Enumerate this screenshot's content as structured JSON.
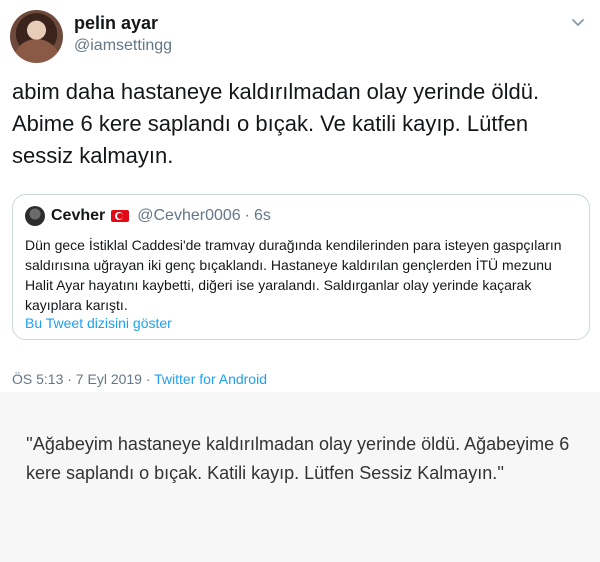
{
  "tweet": {
    "display_name": "pelin ayar",
    "handle": "@iamsettingg",
    "text": "abim daha hastaneye kaldırılmadan olay yerinde öldü. Abime 6 kere saplandı o bıçak. Ve katili kayıp. Lütfen sessiz kalmayın.",
    "timestamp": "ÖS 5:13 · 7 Eyl 2019 · ",
    "source": "Twitter for Android",
    "menu_icon": "chevron-down-icon"
  },
  "quoted_tweet": {
    "display_name": "Cevher",
    "flag_icon": "turkish-flag-icon",
    "handle": "@Cevher0006",
    "separator": "·",
    "time": "6s",
    "text": "Dün gece İstiklal Caddesi'de tramvay durağında kendilerinden para isteyen gaspçıların saldırısına uğrayan iki genç bıçaklandı. Hastaneye kaldırılan gençlerden İTÜ mezunu Halit Ayar hayatını kaybetti, diğeri ise yaralandı. Saldırganlar olay yerinde kaçarak kayıplara karıştı.",
    "thread_link": "Bu Tweet dizisini göster"
  },
  "translation": {
    "text": "''Ağabeyim hastaneye kaldırılmadan olay yerinde öldü. Ağabeyime 6 kere saplandı o bıçak. Katili kayıp. Lütfen Sessiz Kalmayın.''"
  },
  "colors": {
    "link": "#1da1f2",
    "muted": "#657786",
    "border": "#ccd6dd",
    "translation_bg": "#f7f7f7"
  }
}
